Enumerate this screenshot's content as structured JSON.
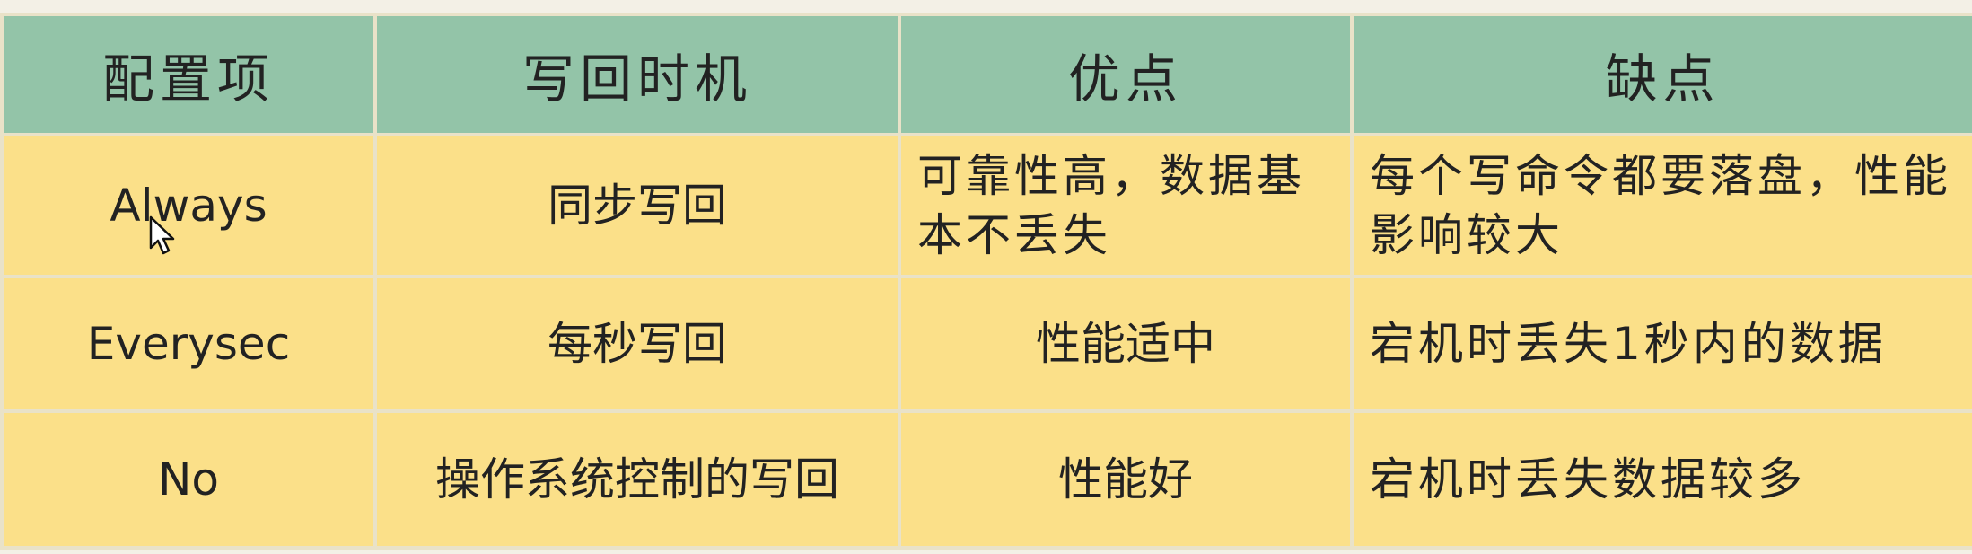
{
  "table": {
    "headers": [
      "配置项",
      "写回时机",
      "优点",
      "缺点"
    ],
    "rows": [
      {
        "config": "Always",
        "timing": "同步写回",
        "pros": "可靠性高，数据基本不丢失",
        "cons": "每个写命令都要落盘，性能影响较大"
      },
      {
        "config": "Everysec",
        "timing": "每秒写回",
        "pros": "性能适中",
        "cons": "宕机时丢失1秒内的数据"
      },
      {
        "config": "No",
        "timing": "操作系统控制的写回",
        "pros": "性能好",
        "cons": "宕机时丢失数据较多"
      }
    ]
  },
  "colors": {
    "header_bg": "#93c4a8",
    "body_bg": "#fbe089",
    "border": "#e9e2c8"
  },
  "icons": {
    "cursor": "mouse-pointer-icon"
  }
}
